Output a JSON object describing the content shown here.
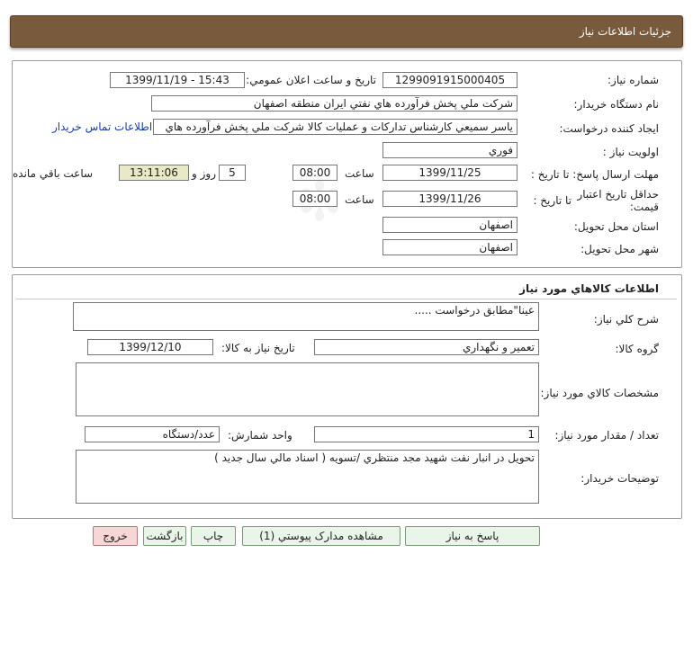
{
  "header": {
    "title": "جزئيات اطلاعات نياز"
  },
  "watermark": {
    "brand": "ParsNamadData"
  },
  "need_info": {
    "need_number_label": "شماره نياز:",
    "need_number": "1299091915000405",
    "announce_label": "تاريخ و ساعت اعلان عمومي:",
    "announce_value": "1399/11/19 - 15:43",
    "buyer_org_label": "نام دستگاه خريدار:",
    "buyer_org": "شرکت ملي پخش فرآورده هاي نفتي ايران منطقه اصفهان",
    "creator_label": "ايجاد کننده درخواست:",
    "creator": "ياسر  سميعي کارشناس تدارکات و عمليات کالا شرکت ملي پخش فرآورده هاي",
    "contact_link": "اطلاعات تماس خريدار",
    "priority_label": "اولويت نياز :",
    "priority": "فوري",
    "deadline_label": "مهلت ارسال پاسخ: تا تاريخ :",
    "deadline_date": "1399/11/25",
    "time_label": "ساعت",
    "deadline_time": "08:00",
    "days_count": "5",
    "days_label": "روز و",
    "remaining_time": "13:11:06",
    "remaining_label": "ساعت باقي مانده",
    "validity_label": "حداقل تاريخ اعتبار قيمت:",
    "validity_to_label": "تا تاريخ :",
    "validity_date": "1399/11/26",
    "validity_time_label": "ساعت",
    "validity_time": "08:00",
    "province_label": "استان محل تحويل:",
    "province": "اصفهان",
    "city_label": "شهر محل تحويل:",
    "city": "اصفهان"
  },
  "goods": {
    "section_title": "اطلاعات کالاهاي مورد نياز",
    "desc_label": "شرح کلي نياز:",
    "desc": "عينا\"مطابق درخواست  .....",
    "group_label": "گروه کالا:",
    "group": "تعمير و نگهداري",
    "need_date_label": "تاريخ نياز به کالا:",
    "need_date": "1399/12/10",
    "specs_label": "مشخصات کالاي مورد نياز:",
    "specs": "",
    "qty_label": "تعداد / مقدار مورد نياز:",
    "qty": "1",
    "unit_label": "واحد شمارش:",
    "unit": "عدد/دستگاه",
    "notes_label": "توضيحات خريدار:",
    "notes": "تحويل در انبار نفت شهيد مجد منتظري /تسويه ( اسناد مالي سال جديد )"
  },
  "actions": {
    "reply": "پاسخ به نياز",
    "attachments": "مشاهده مدارک پيوستي (1)",
    "print": "چاپ",
    "back": "بازگشت",
    "exit": "خروج"
  }
}
